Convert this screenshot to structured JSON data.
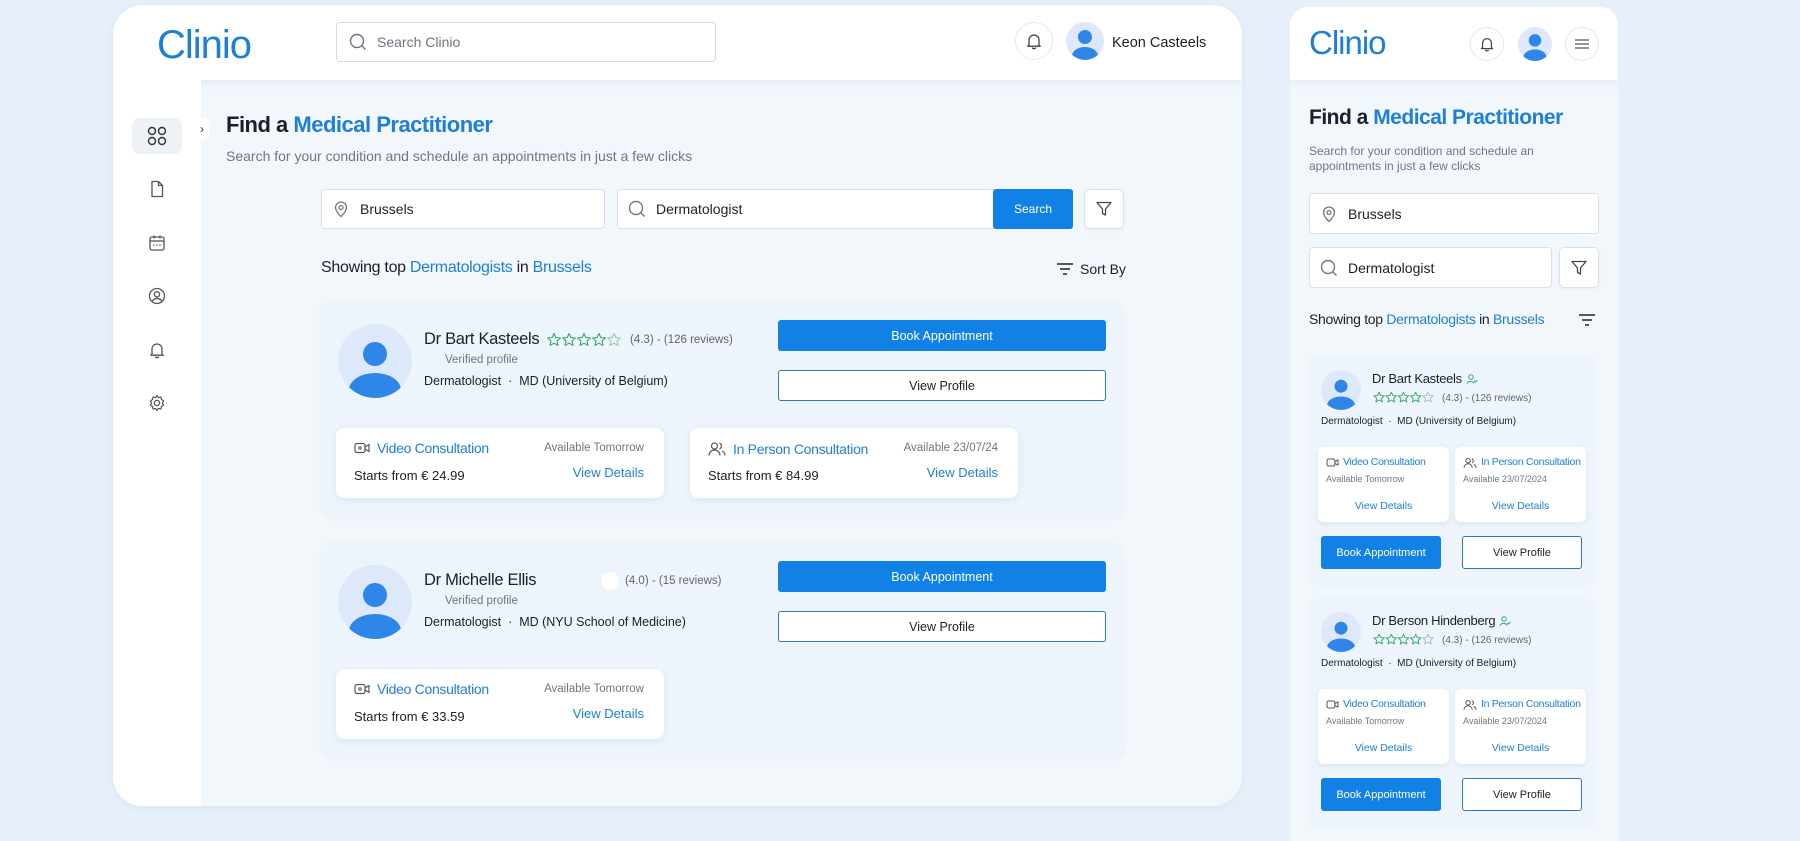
{
  "brand": {
    "name": "Clinio",
    "accent": "#1e7fd6",
    "primary_button": "#1281e6"
  },
  "header": {
    "search_placeholder": "Search Clinio",
    "user_name": "Keon Casteels",
    "icons": [
      "search-icon",
      "bell-icon",
      "avatar",
      "menu-icon"
    ]
  },
  "sidebar": {
    "items": [
      "dashboard-icon",
      "document-icon",
      "calendar-icon",
      "profile-icon",
      "bell-icon",
      "gear-icon"
    ],
    "collapse_glyph": "›"
  },
  "page": {
    "title_prefix": "Find a",
    "title_highlight": "Medical Practitioner",
    "subtitle": "Search for your condition and schedule an appointments in just a few clicks",
    "mobile_subtitle_line1": "Search for your condition and schedule an",
    "mobile_subtitle_line2": "appointments in just a few clicks"
  },
  "search": {
    "location": "Brussels",
    "condition": "Dermatologist",
    "button": "Search"
  },
  "results": {
    "prefix": "Showing top",
    "specialty": "Dermatologists",
    "connector": "in",
    "city": "Brussels",
    "sort_label": "Sort By"
  },
  "doctors": [
    {
      "name": "Dr Bart Kasteels",
      "verified": "Verified profile",
      "rating": "(4.3) - (126 reviews)",
      "stars_filled": 0,
      "specialty": "Dermatologist",
      "separator": "·",
      "degree": "MD (University of Belgium)",
      "book": "Book Appointment",
      "profile": "View Profile",
      "consultations": [
        {
          "type": "Video Consultation",
          "availability": "Available Tomorrow",
          "price": "Starts from € 24.99",
          "link": "View Details"
        },
        {
          "type": "In Person Consultation",
          "availability": "Available 23/07/24",
          "price": "Starts from € 84.99",
          "link": "View Details"
        }
      ]
    },
    {
      "name": "Dr Michelle Ellis",
      "verified": "Verified profile",
      "rating": "(4.0) - (15 reviews)",
      "specialty": "Dermatologist",
      "separator": "·",
      "degree": "MD (NYU School of Medicine)",
      "book": "Book Appointment",
      "profile": "View Profile",
      "consultations": [
        {
          "type": "Video Consultation",
          "availability": "Available Tomorrow",
          "price": "Starts from € 33.59",
          "link": "View Details"
        }
      ]
    }
  ],
  "mobile_doctors": [
    {
      "name": "Dr Bart Kasteels",
      "rating": "(4.3) - (126 reviews)",
      "specialty": "Dermatologist",
      "separator": "·",
      "degree": "MD (University of Belgium)",
      "video": {
        "type": "Video Consultation",
        "availability": "Available Tomorrow",
        "link": "View Details"
      },
      "person": {
        "type": "In Person Consultation",
        "availability": "Available 23/07/2024",
        "link": "View Details"
      },
      "book": "Book Appointment",
      "profile": "View Profile"
    },
    {
      "name": "Dr Berson Hindenberg",
      "rating": "(4.3) - (126 reviews)",
      "specialty": "Dermatologist",
      "separator": "·",
      "degree": "MD (University of Belgium)",
      "video": {
        "type": "Video Consultation",
        "availability": "Available Tomorrow",
        "link": "View Details"
      },
      "person": {
        "type": "In Person Consultation",
        "availability": "Available 23/07/2024",
        "link": "View Details"
      },
      "book": "Book Appointment",
      "profile": "View Profile"
    }
  ]
}
